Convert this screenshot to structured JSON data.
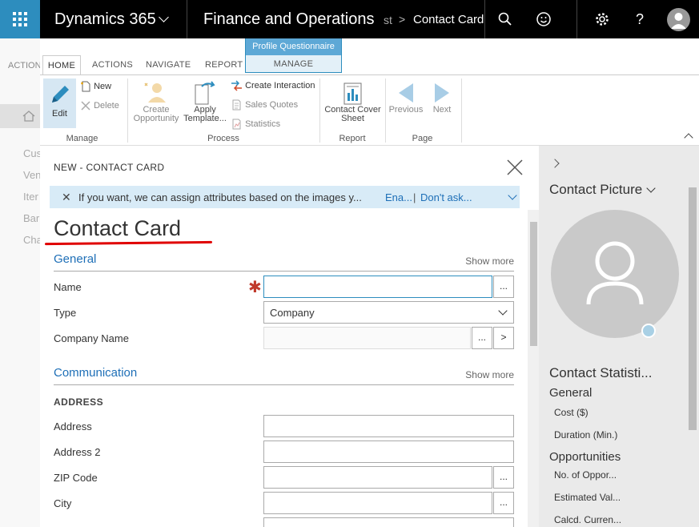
{
  "topbar": {
    "app_title": "Dynamics 365",
    "module_title": "Finance and Operations",
    "breadcrumb_prev": "st",
    "breadcrumb_sep": ">",
    "breadcrumb_current": "Contact Card",
    "icons": [
      "waffle-icon",
      "search-icon",
      "smiley-icon",
      "gear-icon",
      "help-icon",
      "user-avatar"
    ]
  },
  "background_page": {
    "action_tab": "ACTION",
    "nav_items": [
      "Cus",
      "Ven",
      "Iter",
      "Bar",
      "Cha"
    ]
  },
  "ribbon": {
    "tabs": [
      "HOME",
      "ACTIONS",
      "NAVIGATE",
      "REPORT"
    ],
    "active_tab": "HOME",
    "context_tab": {
      "header": "Profile Questionnaire",
      "label": "MANAGE"
    },
    "groups": {
      "manage": {
        "label": "Manage",
        "edit": "Edit",
        "new": "New",
        "delete": "Delete"
      },
      "process": {
        "label": "Process",
        "create_opportunity": [
          "Create",
          "Opportunity"
        ],
        "apply_template": [
          "Apply",
          "Template..."
        ],
        "create_interaction": "Create Interaction",
        "sales_quotes": "Sales Quotes",
        "statistics": "Statistics"
      },
      "report": {
        "label": "Report",
        "contact_cover_sheet": [
          "Contact Cover",
          "Sheet"
        ]
      },
      "page": {
        "label": "Page",
        "previous": "Previous",
        "next": "Next"
      }
    }
  },
  "dialog": {
    "title": "NEW - CONTACT CARD",
    "message": {
      "text": "If you want, we can assign attributes based on the images y...",
      "link1": "Ena...",
      "separator": "|",
      "link2": "Don't ask..."
    },
    "form_title": "Contact Card",
    "sections": {
      "general": {
        "title": "General",
        "show_more": "Show more",
        "fields": {
          "name": {
            "label": "Name",
            "value": "",
            "required": true
          },
          "type": {
            "label": "Type",
            "value": "Company"
          },
          "company_name": {
            "label": "Company Name",
            "value": ""
          }
        }
      },
      "communication": {
        "title": "Communication",
        "show_more": "Show more",
        "subheading": "ADDRESS",
        "fields": {
          "address": {
            "label": "Address",
            "value": ""
          },
          "address2": {
            "label": "Address 2",
            "value": ""
          },
          "zip": {
            "label": "ZIP Code",
            "value": ""
          },
          "city": {
            "label": "City",
            "value": ""
          }
        }
      }
    },
    "lookup_label": "...",
    "goto_label": ">"
  },
  "factbox": {
    "picture_title": "Contact Picture",
    "statistics_title": "Contact Statisti...",
    "general": "General",
    "cost": "Cost ($)",
    "duration": "Duration (Min.)",
    "opportunities": "Opportunities",
    "no_of_opps": "No. of Oppor...",
    "estimated_value": "Estimated Val...",
    "calcd_current": "Calcd. Curren..."
  },
  "colors": {
    "accent": "#2d8dbe",
    "link": "#1e6fb7",
    "required": "#c0392b",
    "underline_annotation": "#e00000"
  }
}
